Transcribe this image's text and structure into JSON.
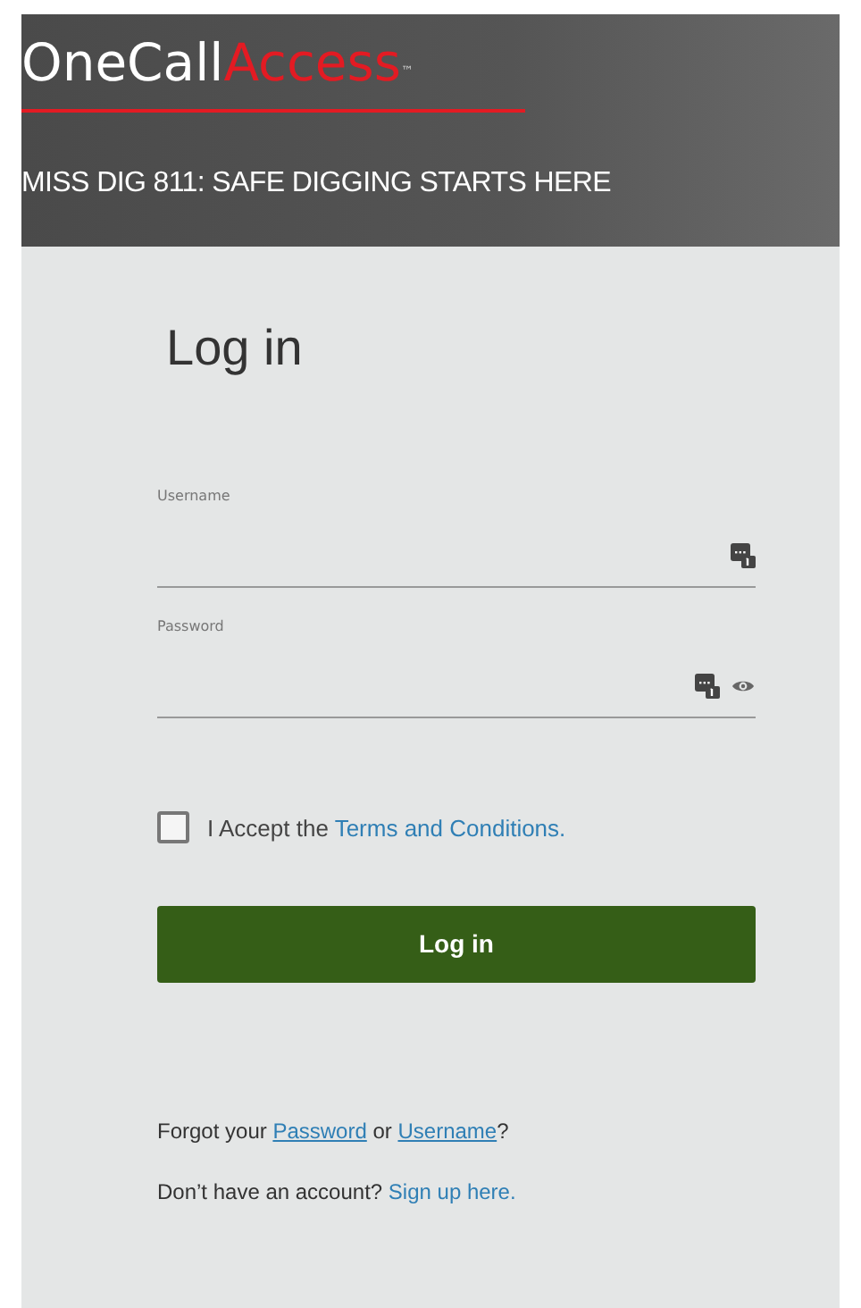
{
  "header": {
    "logo": {
      "part_1": "OneCall",
      "part_2": "Access",
      "mark": "™"
    },
    "tagline": "MISS DIG 811: SAFE DIGGING STARTS HERE"
  },
  "form": {
    "title": "Log in",
    "fields": [
      {
        "label": "Username",
        "kind": "text"
      },
      {
        "label": "Password",
        "kind": "password"
      }
    ],
    "terms": {
      "checked": false,
      "text": "I Accept the",
      "link": "Terms and Conditions."
    },
    "submit": "Log in",
    "forgot": {
      "text_1": "Forgot your",
      "link_1": "Password",
      "text_2": "or",
      "link_2": "Username",
      "text_3": "?"
    },
    "signup": {
      "text": "Don’t have an account?",
      "link": "Sign up here."
    }
  }
}
